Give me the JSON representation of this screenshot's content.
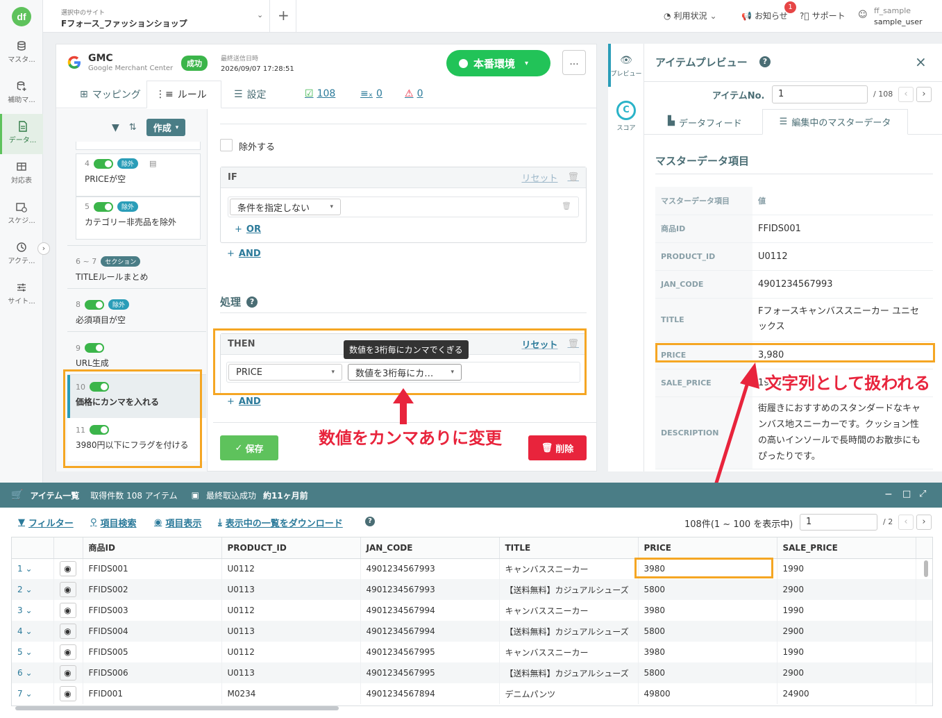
{
  "nav": {
    "logo": "df",
    "items": [
      {
        "label": "マスタ..."
      },
      {
        "label": "補助マ..."
      },
      {
        "label": "データ..."
      },
      {
        "label": "対応表"
      },
      {
        "label": "スケジ..."
      },
      {
        "label": "アクテ..."
      },
      {
        "label": "サイト..."
      }
    ]
  },
  "header": {
    "site_label": "選択中のサイト",
    "site_name": "Fフォース_ファッションショップ",
    "usage": "利用状況",
    "notice": "お知らせ",
    "notice_count": "1",
    "support": "サポート",
    "user_id": "ff_sample",
    "user_name": "sample_user"
  },
  "gmc": {
    "title": "GMC",
    "subtitle": "Google Merchant Center",
    "status": "成功",
    "last_sent_label": "最終送信日時",
    "last_sent": "2026/09/07 17:28:51",
    "env": "本番環境",
    "more": "..."
  },
  "tabs": {
    "mapping": "マッピング",
    "rule": "ルール",
    "settings": "設定",
    "count": "108",
    "excluded": "0",
    "errors": "0"
  },
  "rule_list": {
    "create": "作成",
    "items": [
      {
        "num": "4",
        "badge": "除外",
        "text": "PRICEが空"
      },
      {
        "num": "5",
        "badge": "除外",
        "text": "カテゴリー非売品を除外"
      },
      {
        "num": "6 ~ 7",
        "badge": "セクション",
        "text": "TITLEルールまとめ"
      },
      {
        "num": "8",
        "badge": "除外",
        "text": "必須項目が空"
      },
      {
        "num": "9",
        "badge": "",
        "text": "URL生成"
      },
      {
        "num": "10",
        "badge": "",
        "text": "価格にカンマを入れる"
      },
      {
        "num": "11",
        "badge": "",
        "text": "3980円以下にフラグを付ける"
      }
    ]
  },
  "editor": {
    "exclude": "除外する",
    "if_label": "IF",
    "reset": "リセット",
    "condition": "条件を指定しない",
    "or": "OR",
    "and": "AND",
    "process": "処理",
    "then_label": "THEN",
    "then_field": "PRICE",
    "then_op": "数値を3桁毎にカ…",
    "tooltip": "数値を3桁毎にカンマでくぎる",
    "save": "保存",
    "delete": "削除"
  },
  "annotations": {
    "left": "数値をカンマありに変更",
    "right": "文字列として扱われる"
  },
  "preview": {
    "strip_preview": "プレビュー",
    "strip_score": "スコア",
    "title": "アイテムプレビュー",
    "item_no_label": "アイテムNo.",
    "item_no": "1",
    "item_total": "/ 108",
    "tab_feed": "データフィード",
    "tab_master": "編集中のマスターデータ",
    "section": "マスターデータ項目",
    "col_key": "マスターデータ項目",
    "col_val": "値",
    "rows": [
      {
        "k": "商品ID",
        "v": "FFIDS001"
      },
      {
        "k": "PRODUCT_ID",
        "v": "U0112"
      },
      {
        "k": "JAN_CODE",
        "v": "4901234567993"
      },
      {
        "k": "TITLE",
        "v": "Fフォースキャンバススニーカー ユニセックス"
      },
      {
        "k": "PRICE",
        "v": "3,980"
      },
      {
        "k": "SALE_PRICE",
        "v": "1990"
      },
      {
        "k": "DESCRIPTION",
        "v": "街履きにおすすめのスタンダードなキャンバス地スニーカーです。クッション性の高いインソールで長時間のお散歩にもぴったりです。"
      }
    ]
  },
  "bottom": {
    "title": "アイテム一覧",
    "count": "取得件数 108 アイテム",
    "last_label": "最終取込成功",
    "last_val": "約11ヶ月前",
    "filter": "フィルター",
    "search": "項目検索",
    "display": "項目表示",
    "download": "表示中の一覧をダウンロード",
    "range": "108件(1 ~ 100 を表示中)",
    "page": "1",
    "pages": "/ 2",
    "columns": [
      "商品ID",
      "PRODUCT_ID",
      "JAN_CODE",
      "TITLE",
      "PRICE",
      "SALE_PRICE"
    ],
    "rows": [
      [
        "1",
        "FFIDS001",
        "U0112",
        "4901234567993",
        "キャンバススニーカー",
        "3980",
        "1990"
      ],
      [
        "2",
        "FFIDS002",
        "U0113",
        "4901234567993",
        "【送料無料】カジュアルシューズ",
        "5800",
        "2900"
      ],
      [
        "3",
        "FFIDS003",
        "U0112",
        "4901234567994",
        "キャンバススニーカー",
        "3980",
        "1990"
      ],
      [
        "4",
        "FFIDS004",
        "U0113",
        "4901234567994",
        "【送料無料】カジュアルシューズ",
        "5800",
        "2900"
      ],
      [
        "5",
        "FFIDS005",
        "U0112",
        "4901234567995",
        "キャンバススニーカー",
        "3980",
        "1990"
      ],
      [
        "6",
        "FFIDS006",
        "U0113",
        "4901234567995",
        "【送料無料】カジュアルシューズ",
        "5800",
        "2900"
      ],
      [
        "7",
        "FFID001",
        "M0234",
        "4901234567894",
        "デニムパンツ",
        "49800",
        "24900"
      ]
    ]
  }
}
